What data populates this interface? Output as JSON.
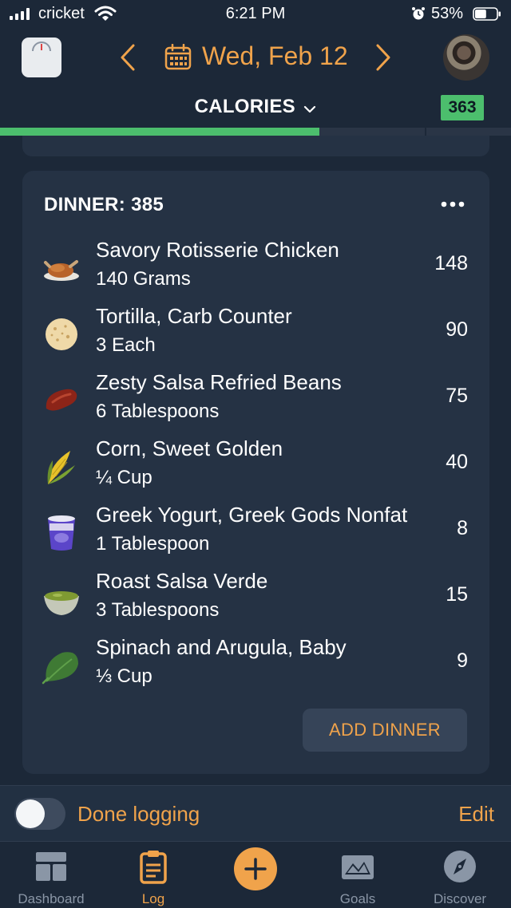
{
  "status_bar": {
    "carrier": "cricket",
    "time": "6:21 PM",
    "battery_percent": "53%",
    "battery_level": 0.53,
    "icons": [
      "signal-icon",
      "wifi-icon",
      "alarm-icon",
      "battery-icon"
    ]
  },
  "header": {
    "date": "Wed, Feb 12",
    "metric_label": "CALORIES",
    "metric_value": "363",
    "progress_fraction": 0.625,
    "icons": [
      "scale-icon",
      "chevron-left-icon",
      "calendar-icon",
      "chevron-right-icon",
      "avatar",
      "chevron-down-icon"
    ]
  },
  "meal": {
    "title": "DINNER: 385",
    "add_label": "ADD DINNER",
    "items": [
      {
        "name": "Savory Rotisserie Chicken",
        "portion": "140 Grams",
        "calories": "148",
        "icon": "roast-chicken-icon"
      },
      {
        "name": "Tortilla, Carb Counter",
        "portion": "3 Each",
        "calories": "90",
        "icon": "tortilla-icon"
      },
      {
        "name": "Zesty Salsa Refried Beans",
        "portion": "6 Tablespoons",
        "calories": "75",
        "icon": "bean-icon"
      },
      {
        "name": "Corn, Sweet Golden",
        "portion": "¼ Cup",
        "calories": "40",
        "icon": "corn-icon"
      },
      {
        "name": "Greek Yogurt, Greek Gods Nonfat",
        "portion": "1 Tablespoon",
        "calories": "8",
        "icon": "yogurt-cup-icon"
      },
      {
        "name": "Roast Salsa Verde",
        "portion": "3 Tablespoons",
        "calories": "15",
        "icon": "salsa-bowl-icon"
      },
      {
        "name": "Spinach and Arugula, Baby",
        "portion": "⅓ Cup",
        "calories": "9",
        "icon": "spinach-leaf-icon"
      }
    ]
  },
  "done_bar": {
    "label": "Done logging",
    "edit": "Edit",
    "toggle_on": false
  },
  "tabs": [
    {
      "label": "Dashboard",
      "icon": "dashboard-icon",
      "active": false
    },
    {
      "label": "Log",
      "icon": "log-clipboard-icon",
      "active": true
    },
    {
      "label": "",
      "icon": "plus-icon",
      "active": false
    },
    {
      "label": "Goals",
      "icon": "goals-mountain-icon",
      "active": false
    },
    {
      "label": "Discover",
      "icon": "compass-icon",
      "active": false
    }
  ],
  "colors": {
    "accent": "#f0a34b",
    "success": "#4cbe6d",
    "background": "#1c2838",
    "card": "#253244"
  }
}
